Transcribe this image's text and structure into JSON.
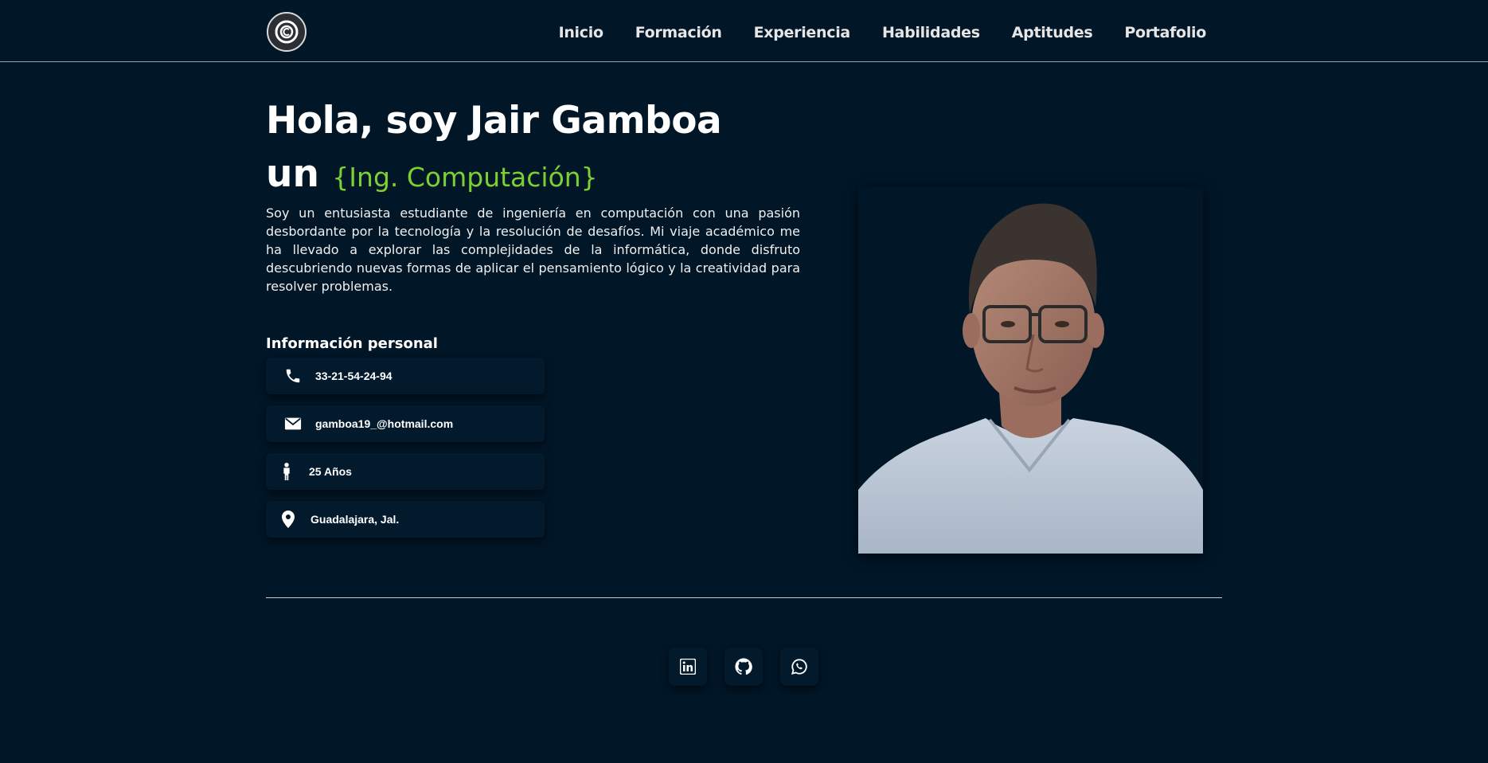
{
  "header": {
    "logo_icon": "copyright-icon",
    "nav": [
      "Inicio",
      "Formación",
      "Experiencia",
      "Habilidades",
      "Aptitudes",
      "Portafolio"
    ]
  },
  "hero": {
    "greeting": "Hola, soy Jair Gamboa",
    "prefix": "un",
    "role": "{Ing. Computación}",
    "bio": "Soy un entusiasta estudiante de ingeniería en computación con una pasión desbordante por la tecnología y la resolución de desafíos. Mi viaje académico me ha llevado a explorar las complejidades de la informática, donde disfruto descubriendo nuevas formas de aplicar el pensamiento lógico y la creatividad para resolver problemas.",
    "accent_color": "#7bd133"
  },
  "personal": {
    "title": "Información personal",
    "items": [
      {
        "icon": "phone-icon",
        "text": "33-21-54-24-94"
      },
      {
        "icon": "envelope-icon",
        "text": "gamboa19_@hotmail.com"
      },
      {
        "icon": "person-icon",
        "text": "25 Años"
      },
      {
        "icon": "location-pin-icon",
        "text": "Guadalajara, Jal."
      }
    ]
  },
  "social": [
    {
      "icon": "linkedin-icon"
    },
    {
      "icon": "github-icon"
    },
    {
      "icon": "whatsapp-icon"
    }
  ],
  "colors": {
    "background": "#011627",
    "card": "#021a2c",
    "accent": "#7bd133"
  }
}
